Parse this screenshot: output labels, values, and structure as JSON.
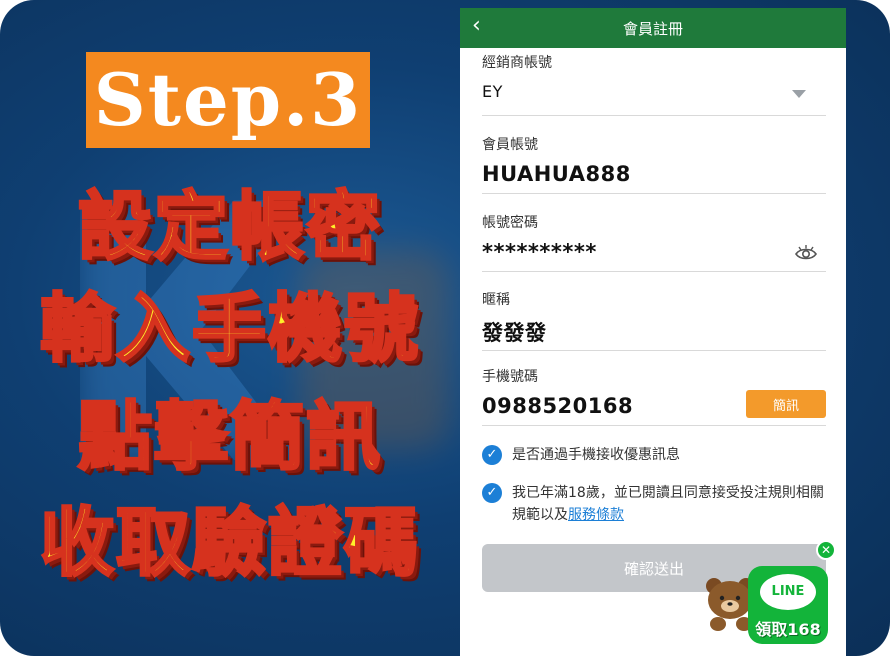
{
  "promo": {
    "step": "Step.3",
    "lines": [
      "設定帳密",
      "輸入手機號",
      "點擊簡訊",
      "收取驗證碼"
    ]
  },
  "app": {
    "title": "會員註冊",
    "dealer": {
      "label": "經銷商帳號",
      "value": "EY"
    },
    "account": {
      "label": "會員帳號",
      "value": "HUAHUA888"
    },
    "password": {
      "label": "帳號密碼",
      "value": "**********"
    },
    "nickname": {
      "label": "暱稱",
      "value": "發發發"
    },
    "phone": {
      "label": "手機號碼",
      "value": "0988520168",
      "sms_button": "簡訊"
    },
    "consent_sms": "是否通過手機接收優惠訊息",
    "consent_terms": "我已年滿18歲，並已閱讀且同意接受投注規則相關規範以及",
    "terms_link": "服務條款",
    "submit": "確認送出"
  },
  "line_widget": {
    "bubble": "LINE",
    "caption": "領取168"
  },
  "colors": {
    "appbar": "#1f7a3b",
    "accent": "#f39a2b",
    "check": "#1c7fd6",
    "line_green": "#13b43a"
  }
}
